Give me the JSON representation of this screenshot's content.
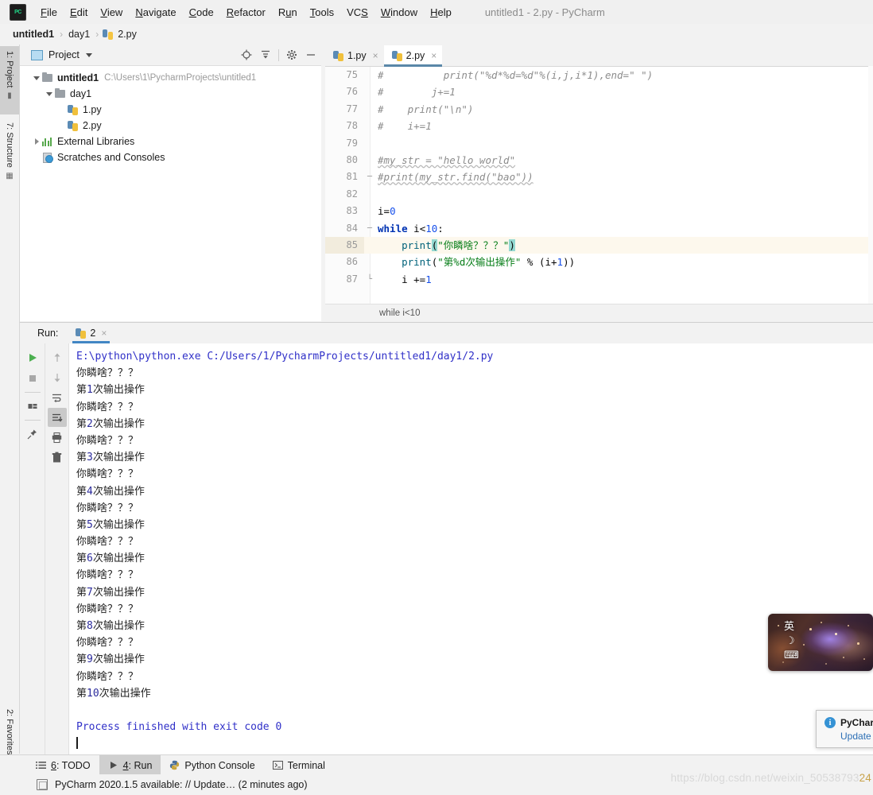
{
  "window": {
    "title": "untitled1 - 2.py - PyCharm",
    "logo_text": "PC"
  },
  "menubar": {
    "items": [
      {
        "label": "File",
        "mnemonic": "F"
      },
      {
        "label": "Edit",
        "mnemonic": "E"
      },
      {
        "label": "View",
        "mnemonic": "V"
      },
      {
        "label": "Navigate",
        "mnemonic": "N"
      },
      {
        "label": "Code",
        "mnemonic": "C"
      },
      {
        "label": "Refactor",
        "mnemonic": "R"
      },
      {
        "label": "Run",
        "mnemonic": "u"
      },
      {
        "label": "Tools",
        "mnemonic": "T"
      },
      {
        "label": "VCS",
        "mnemonic": "S"
      },
      {
        "label": "Window",
        "mnemonic": "W"
      },
      {
        "label": "Help",
        "mnemonic": "H"
      }
    ]
  },
  "breadcrumb": {
    "project": "untitled1",
    "folder": "day1",
    "file": "2.py",
    "separator": "›"
  },
  "left_strip": {
    "project_tab": "1: Project",
    "structure_tab": "7: Structure",
    "favorites_tab": "2: Favorites"
  },
  "project_panel": {
    "title": "Project",
    "tools": [
      "locate-icon",
      "collapse-all-icon",
      "settings-icon",
      "hide-icon"
    ],
    "tree": [
      {
        "label": "untitled1",
        "path": "C:\\Users\\1\\PycharmProjects\\untitled1",
        "type": "project",
        "expanded": true,
        "indent": 0
      },
      {
        "label": "day1",
        "path": "",
        "type": "folder",
        "expanded": true,
        "indent": 1
      },
      {
        "label": "1.py",
        "path": "",
        "type": "python",
        "expanded": null,
        "indent": 2
      },
      {
        "label": "2.py",
        "path": "",
        "type": "python",
        "expanded": null,
        "indent": 2
      },
      {
        "label": "External Libraries",
        "path": "",
        "type": "library",
        "expanded": false,
        "indent": 0
      },
      {
        "label": "Scratches and Consoles",
        "path": "",
        "type": "scratch",
        "expanded": null,
        "indent": 0
      }
    ]
  },
  "editor": {
    "tabs": [
      {
        "label": "1.py",
        "active": false
      },
      {
        "label": "2.py",
        "active": true
      }
    ],
    "close_glyph": "×",
    "breadcrumb_text": "while i<10",
    "first_line_number": 75,
    "lines": [
      {
        "no": 75,
        "fold": "",
        "highlight": false,
        "tokens": [
          {
            "t": "#          print(\"%d*%d=%d\"%(i,j,i*1),end=\" \")",
            "c": "cmt"
          }
        ]
      },
      {
        "no": 76,
        "fold": "",
        "highlight": false,
        "tokens": [
          {
            "t": "#        j+=1",
            "c": "cmt"
          }
        ]
      },
      {
        "no": 77,
        "fold": "",
        "highlight": false,
        "tokens": [
          {
            "t": "#    print(\"\\n\")",
            "c": "cmt"
          }
        ]
      },
      {
        "no": 78,
        "fold": "",
        "highlight": false,
        "tokens": [
          {
            "t": "#    i+=1",
            "c": "cmt"
          }
        ]
      },
      {
        "no": 79,
        "fold": "",
        "highlight": false,
        "tokens": []
      },
      {
        "no": 80,
        "fold": "",
        "highlight": false,
        "tokens": [
          {
            "t": "#my_str = \"hello world\"",
            "c": "cmt sqwig"
          }
        ]
      },
      {
        "no": 81,
        "fold": "─",
        "highlight": false,
        "tokens": [
          {
            "t": "#print(my_str.find(\"bao\"))",
            "c": "cmt sqwig"
          }
        ]
      },
      {
        "no": 82,
        "fold": "",
        "highlight": false,
        "tokens": []
      },
      {
        "no": 83,
        "fold": "",
        "highlight": false,
        "tokens": [
          {
            "t": "i=",
            "c": "plain"
          },
          {
            "t": "0",
            "c": "num"
          }
        ]
      },
      {
        "no": 84,
        "fold": "─",
        "highlight": false,
        "tokens": [
          {
            "t": "while",
            "c": "kw"
          },
          {
            "t": " i<",
            "c": "plain"
          },
          {
            "t": "10",
            "c": "num"
          },
          {
            "t": ":",
            "c": "plain"
          }
        ]
      },
      {
        "no": 85,
        "fold": "",
        "highlight": true,
        "tokens": [
          {
            "t": "    ",
            "c": "plain"
          },
          {
            "t": "print",
            "c": "fn"
          },
          {
            "t": "(",
            "c": "plain brmatch"
          },
          {
            "t": "\"你瞵啥？？？\"",
            "c": "str"
          },
          {
            "t": ")",
            "c": "plain brmatch"
          }
        ]
      },
      {
        "no": 86,
        "fold": "",
        "highlight": false,
        "tokens": [
          {
            "t": "    ",
            "c": "plain"
          },
          {
            "t": "print",
            "c": "fn"
          },
          {
            "t": "(",
            "c": "plain"
          },
          {
            "t": "\"第%d次输出操作\"",
            "c": "str"
          },
          {
            "t": " % (i+",
            "c": "plain"
          },
          {
            "t": "1",
            "c": "num"
          },
          {
            "t": "))",
            "c": "plain"
          }
        ]
      },
      {
        "no": 87,
        "fold": "└",
        "highlight": false,
        "tokens": [
          {
            "t": "    i +=",
            "c": "plain"
          },
          {
            "t": "1",
            "c": "num"
          }
        ]
      }
    ]
  },
  "run_panel": {
    "label": "Run:",
    "tab_name": "2",
    "close_glyph": "×",
    "toolbar_left": [
      "rerun-icon",
      "stop-icon",
      "restore-layout-icon",
      "pin-tab-icon"
    ],
    "toolbar_right": [
      "up-arrow-icon",
      "down-arrow-icon",
      "soft-wrap-icon",
      "scroll-to-end-icon",
      "print-icon",
      "clear-all-icon"
    ],
    "console_lines": [
      {
        "text": "E:\\python\\python.exe C:/Users/1/PycharmProjects/untitled1/day1/2.py",
        "kind": "cmd"
      },
      {
        "text": "你瞵啥？？？",
        "kind": "out"
      },
      {
        "text": "第1次输出操作",
        "kind": "out"
      },
      {
        "text": "你瞵啥？？？",
        "kind": "out"
      },
      {
        "text": "第2次输出操作",
        "kind": "out"
      },
      {
        "text": "你瞵啥？？？",
        "kind": "out"
      },
      {
        "text": "第3次输出操作",
        "kind": "out"
      },
      {
        "text": "你瞵啥？？？",
        "kind": "out"
      },
      {
        "text": "第4次输出操作",
        "kind": "out"
      },
      {
        "text": "你瞵啥？？？",
        "kind": "out"
      },
      {
        "text": "第5次输出操作",
        "kind": "out"
      },
      {
        "text": "你瞵啥？？？",
        "kind": "out"
      },
      {
        "text": "第6次输出操作",
        "kind": "out"
      },
      {
        "text": "你瞵啥？？？",
        "kind": "out"
      },
      {
        "text": "第7次输出操作",
        "kind": "out"
      },
      {
        "text": "你瞵啥？？？",
        "kind": "out"
      },
      {
        "text": "第8次输出操作",
        "kind": "out"
      },
      {
        "text": "你瞵啥？？？",
        "kind": "out"
      },
      {
        "text": "第9次输出操作",
        "kind": "out"
      },
      {
        "text": "你瞵啥？？？",
        "kind": "out"
      },
      {
        "text": "第10次输出操作",
        "kind": "out"
      },
      {
        "text": "",
        "kind": "out"
      },
      {
        "text": "Process finished with exit code 0",
        "kind": "finish"
      }
    ]
  },
  "toolwindow_bar": {
    "buttons": [
      {
        "label": "6: TODO",
        "mnemonic": "6",
        "icon": "todo-list-icon",
        "active": false
      },
      {
        "label": "4: Run",
        "mnemonic": "4",
        "icon": "run-triangle-icon",
        "active": true
      },
      {
        "label": "Python Console",
        "mnemonic": "",
        "icon": "python-icon",
        "active": false
      },
      {
        "label": "Terminal",
        "mnemonic": "",
        "icon": "terminal-icon",
        "active": false
      }
    ]
  },
  "statusbar": {
    "message": "PyCharm 2020.1.5 available: // Update… (2 minutes ago)"
  },
  "watermark": {
    "text": "https://blog.csdn.net/weixin_50538793",
    "tail": "24"
  },
  "ime_widget": {
    "mode_label": "英",
    "moon_glyph": "☽",
    "keyboard_glyph": "⌨"
  },
  "notification": {
    "title": "PyChar",
    "link": "Update",
    "info_glyph": "i"
  },
  "colors": {
    "accent_tab": "#4286c4",
    "keyword": "#0033b3",
    "string": "#067d17",
    "comment": "#8c8c8c",
    "number": "#1750eb",
    "function": "#00627a",
    "bracket_match": "#93d9d1",
    "console_blue": "#3030c8",
    "chrome_bg": "#f2f2f2"
  }
}
